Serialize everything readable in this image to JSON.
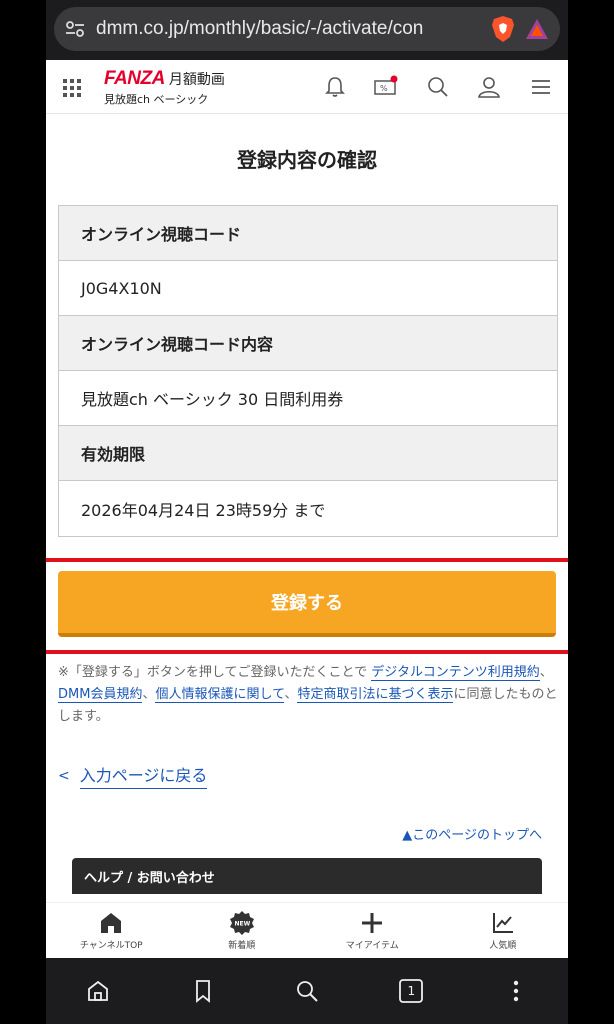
{
  "browser": {
    "url": "dmm.co.jp/monthly/basic/-/activate/con",
    "tab_count": "1"
  },
  "header": {
    "logo_brand": "FANZA",
    "logo_service": "月額動画",
    "logo_plan": "見放題ch ベーシック"
  },
  "main": {
    "title": "登録内容の確認",
    "table": [
      {
        "label": "オンライン視聴コード",
        "value": "J0G4X10N"
      },
      {
        "label": "オンライン視聴コード内容",
        "value": "見放題ch ベーシック 30 日間利用券"
      },
      {
        "label": "有効期限",
        "value": "2026年04月24日 23時59分 まで"
      }
    ],
    "register_button": "登録する",
    "agreement": {
      "prefix": "※「登録する」ボタンを押してご登録いただくことで",
      "link1": "デジタルコンテンツ利用規約",
      "sep1": "、",
      "link2": "DMM会員規約",
      "sep2": "、",
      "link3": "個人情報保護に関して",
      "sep3": "、",
      "link4": "特定商取引法に基づく表示",
      "suffix": "に同意したものとします。"
    },
    "back_link": "入力ページに戻る",
    "back_chevron": "<",
    "to_top": "▲このページのトップへ",
    "help_title": "ヘルプ / お問い合わせ"
  },
  "bottom_nav": [
    {
      "label": "チャンネルTOP",
      "icon": "home-icon"
    },
    {
      "label": "新着順",
      "icon": "new-badge-icon"
    },
    {
      "label": "マイアイテム",
      "icon": "plus-icon"
    },
    {
      "label": "人気順",
      "icon": "trend-chart-icon"
    }
  ],
  "colors": {
    "brand": "#e4002b",
    "button": "#f6a623",
    "link": "#1a56b8",
    "highlight": "#e0101c"
  }
}
